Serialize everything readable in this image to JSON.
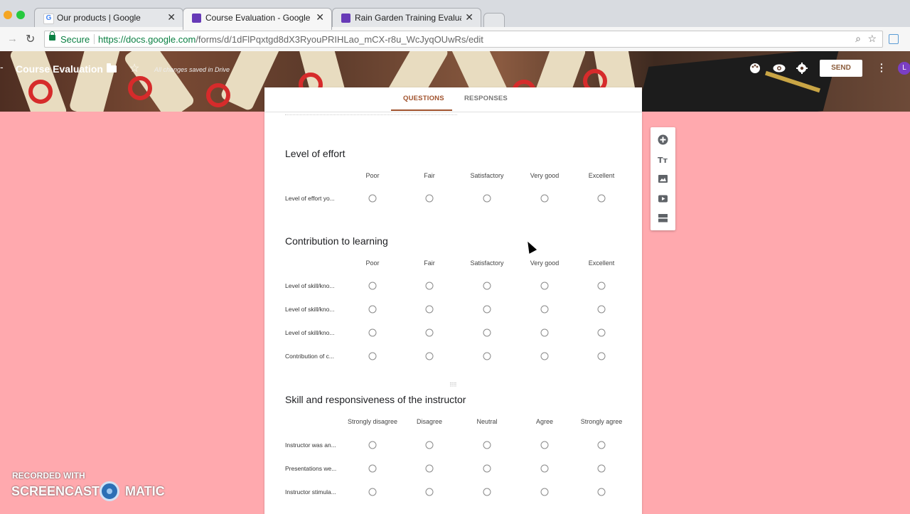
{
  "browser": {
    "tabs": [
      {
        "title": "Our products | Google",
        "active": false
      },
      {
        "title": "Course Evaluation - Google Fo",
        "active": true
      },
      {
        "title": "Rain Garden Training Evaluatio",
        "active": false
      }
    ],
    "secure_label": "Secure",
    "url_host": "https://docs.google.com",
    "url_path": "/forms/d/1dFlPqxtgd8dX3RyouPRIHLao_mCX-r8u_WcJyqOUwRs/edit"
  },
  "header": {
    "title": "Course Evaluation",
    "saved_status": "All changes saved in Drive",
    "send_label": "SEND",
    "avatar_letter": "L",
    "accent": "#a0522d"
  },
  "form_tabs": {
    "questions": "QUESTIONS",
    "responses": "RESPONSES"
  },
  "sections": [
    {
      "title": "Level of effort",
      "columns": [
        "Poor",
        "Fair",
        "Satisfactory",
        "Very good",
        "Excellent"
      ],
      "rows": [
        "Level of effort yo..."
      ]
    },
    {
      "title": "Contribution to learning",
      "columns": [
        "Poor",
        "Fair",
        "Satisfactory",
        "Very good",
        "Excellent"
      ],
      "rows": [
        "Level of skill/kno...",
        "Level of skill/kno...",
        "Level of skill/kno...",
        "Contribution of c..."
      ]
    },
    {
      "title": "Skill and responsiveness of the instructor",
      "columns": [
        "Strongly disagree",
        "Disagree",
        "Neutral",
        "Agree",
        "Strongly agree"
      ],
      "rows": [
        "Instructor was an...",
        "Presentations we...",
        "Instructor stimula..."
      ]
    }
  ],
  "watermark": {
    "recorded_with": "RECORDED WITH",
    "brand_left": "SCREENCAST",
    "brand_right": "MATIC"
  },
  "icons": [
    "palette-icon",
    "preview-eye-icon",
    "settings-gear-icon",
    "more-vert-icon",
    "add-question-icon",
    "add-title-icon",
    "add-image-icon",
    "add-video-icon",
    "add-section-icon"
  ]
}
